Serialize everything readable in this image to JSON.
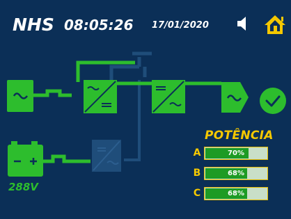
{
  "header": {
    "logo": "NHS",
    "time": "08:05:26",
    "date": "17/01/2020",
    "speaker_icon": "speaker-icon",
    "home_icon": "home-icon"
  },
  "colors": {
    "background": "#0b2f57",
    "active": "#2dbd2d",
    "inactive": "#1f4d7a",
    "accent": "#f5c800"
  },
  "diagram": {
    "input_symbol": "sine-wave-icon",
    "rectifier_symbol": "ac-dc-converter-icon",
    "inverter_symbol": "dc-ac-converter-icon",
    "output_symbol": "sine-wave-icon",
    "status_symbol": "check-icon",
    "charger_symbol": "battery-converter-icon",
    "battery_symbol": "battery-icon"
  },
  "battery": {
    "voltage": "288V"
  },
  "power": {
    "title": "POTÊNCIA",
    "phases": [
      {
        "label": "A",
        "percent": 70,
        "text": "70%"
      },
      {
        "label": "B",
        "percent": 68,
        "text": "68%"
      },
      {
        "label": "C",
        "percent": 68,
        "text": "68%"
      }
    ]
  }
}
